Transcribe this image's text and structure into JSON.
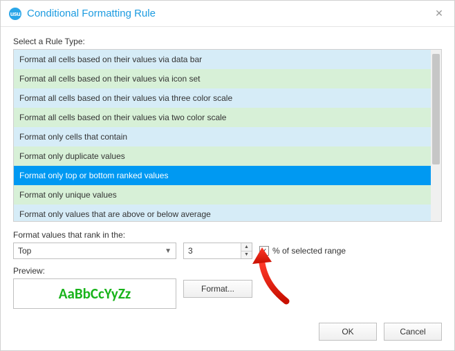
{
  "window": {
    "title": "Conditional Formatting Rule",
    "icon_label": "usu"
  },
  "rule_section": {
    "label": "Select a Rule Type:",
    "items": [
      "Format all cells based on their values via data bar",
      "Format all cells based on their values via icon set",
      "Format all cells based on their values via three color scale",
      "Format all cells based on their values via two color scale",
      "Format only cells that contain",
      "Format only duplicate values",
      "Format only top or bottom ranked values",
      "Format only unique values",
      "Format only values that are above or below average"
    ],
    "selected_index": 6
  },
  "rank_section": {
    "label": "Format values that rank in the:",
    "direction": "Top",
    "count": "3",
    "percent_checked": true,
    "percent_label": "% of selected range",
    "checkmark": "✓"
  },
  "preview": {
    "label": "Preview:",
    "sample_text": "AaBbCcYyZz",
    "format_button": "Format..."
  },
  "footer": {
    "ok": "OK",
    "cancel": "Cancel"
  }
}
